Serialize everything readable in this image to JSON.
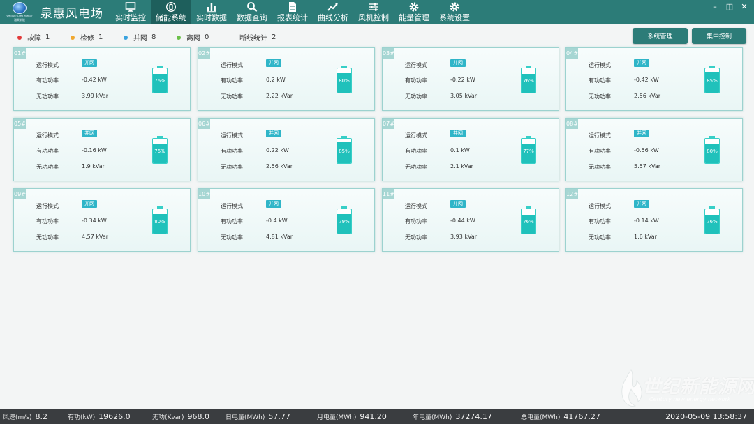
{
  "app": {
    "brand_title": "泉惠风电场",
    "logo_caption_en": "WEICHAI SUPER ENERGY",
    "logo_caption_cn": "潍柴新能"
  },
  "nav": [
    {
      "label": "实时监控",
      "icon": "monitor-icon"
    },
    {
      "label": "储能系统",
      "icon": "storage-icon",
      "active": true
    },
    {
      "label": "实时数据",
      "icon": "bar-chart-icon"
    },
    {
      "label": "数据查询",
      "icon": "search-icon"
    },
    {
      "label": "报表统计",
      "icon": "document-icon"
    },
    {
      "label": "曲线分析",
      "icon": "trend-icon"
    },
    {
      "label": "风机控制",
      "icon": "sliders-icon"
    },
    {
      "label": "能量管理",
      "icon": "gear-icon"
    },
    {
      "label": "系统设置",
      "icon": "gear-icon"
    }
  ],
  "window_controls": {
    "minimize": "–",
    "restore": "◫",
    "close": "✕"
  },
  "legend": [
    {
      "label": "故障",
      "count": "1",
      "color": "#e23b3b"
    },
    {
      "label": "检修",
      "count": "1",
      "color": "#f0a830"
    },
    {
      "label": "并网",
      "count": "8",
      "color": "#3aa3df"
    },
    {
      "label": "离网",
      "count": "0",
      "color": "#6cc04a"
    },
    {
      "label": "断线统计",
      "count": "2",
      "color": ""
    }
  ],
  "toolbar": {
    "system_manage": "系统管理",
    "central_control": "集中控制"
  },
  "field_labels": {
    "mode": "运行模式",
    "active_power": "有功功率",
    "reactive_power": "无功功率"
  },
  "units": [
    {
      "id": "01#",
      "mode": "并网",
      "active": "-0.42 kW",
      "reactive": "3.99 kVar",
      "soc": 76,
      "soc_text": "76%"
    },
    {
      "id": "02#",
      "mode": "并网",
      "active": "0.2 kW",
      "reactive": "2.22 kVar",
      "soc": 80,
      "soc_text": "80%"
    },
    {
      "id": "03#",
      "mode": "并网",
      "active": "-0.22 kW",
      "reactive": "3.05 kVar",
      "soc": 76,
      "soc_text": "76%"
    },
    {
      "id": "04#",
      "mode": "并网",
      "active": "-0.42 kW",
      "reactive": "2.56 kVar",
      "soc": 85,
      "soc_text": "85%"
    },
    {
      "id": "05#",
      "mode": "并网",
      "active": "-0.16 kW",
      "reactive": "1.9 kVar",
      "soc": 76,
      "soc_text": "76%"
    },
    {
      "id": "06#",
      "mode": "并网",
      "active": "0.22 kW",
      "reactive": "2.56 kVar",
      "soc": 85,
      "soc_text": "85%"
    },
    {
      "id": "07#",
      "mode": "并网",
      "active": "0.1 kW",
      "reactive": "2.1 kVar",
      "soc": 77,
      "soc_text": "77%"
    },
    {
      "id": "08#",
      "mode": "并网",
      "active": "-0.56 kW",
      "reactive": "5.57 kVar",
      "soc": 80,
      "soc_text": "80%"
    },
    {
      "id": "09#",
      "mode": "并网",
      "active": "-0.34 kW",
      "reactive": "4.57 kVar",
      "soc": 80,
      "soc_text": "80%"
    },
    {
      "id": "10#",
      "mode": "并网",
      "active": "-0.4 kW",
      "reactive": "4.81 kVar",
      "soc": 79,
      "soc_text": "79%"
    },
    {
      "id": "11#",
      "mode": "并网",
      "active": "-0.44 kW",
      "reactive": "3.93 kVar",
      "soc": 76,
      "soc_text": "76%"
    },
    {
      "id": "12#",
      "mode": "并网",
      "active": "-0.14 kW",
      "reactive": "1.6 kVar",
      "soc": 76,
      "soc_text": "76%"
    }
  ],
  "statusbar": [
    {
      "label": "风速(m/s)",
      "value": "8.2"
    },
    {
      "label": "有功(kW)",
      "value": "19626.0"
    },
    {
      "label": "无功(Kvar)",
      "value": "968.0"
    },
    {
      "label": "日电量(MWh)",
      "value": "57.77"
    },
    {
      "label": "月电量(MWh)",
      "value": "941.20"
    },
    {
      "label": "年电量(MWh)",
      "value": "37274.17"
    },
    {
      "label": "总电量(MWh)",
      "value": "41767.27"
    }
  ],
  "clock": "2020-05-09 13:58:37",
  "watermark": {
    "text": "世纪新能源网",
    "sub": "Century new energy network"
  },
  "colors": {
    "header": "#2c7c78",
    "accent": "#20c1bb",
    "mode_badge": "#2fb5c8"
  }
}
